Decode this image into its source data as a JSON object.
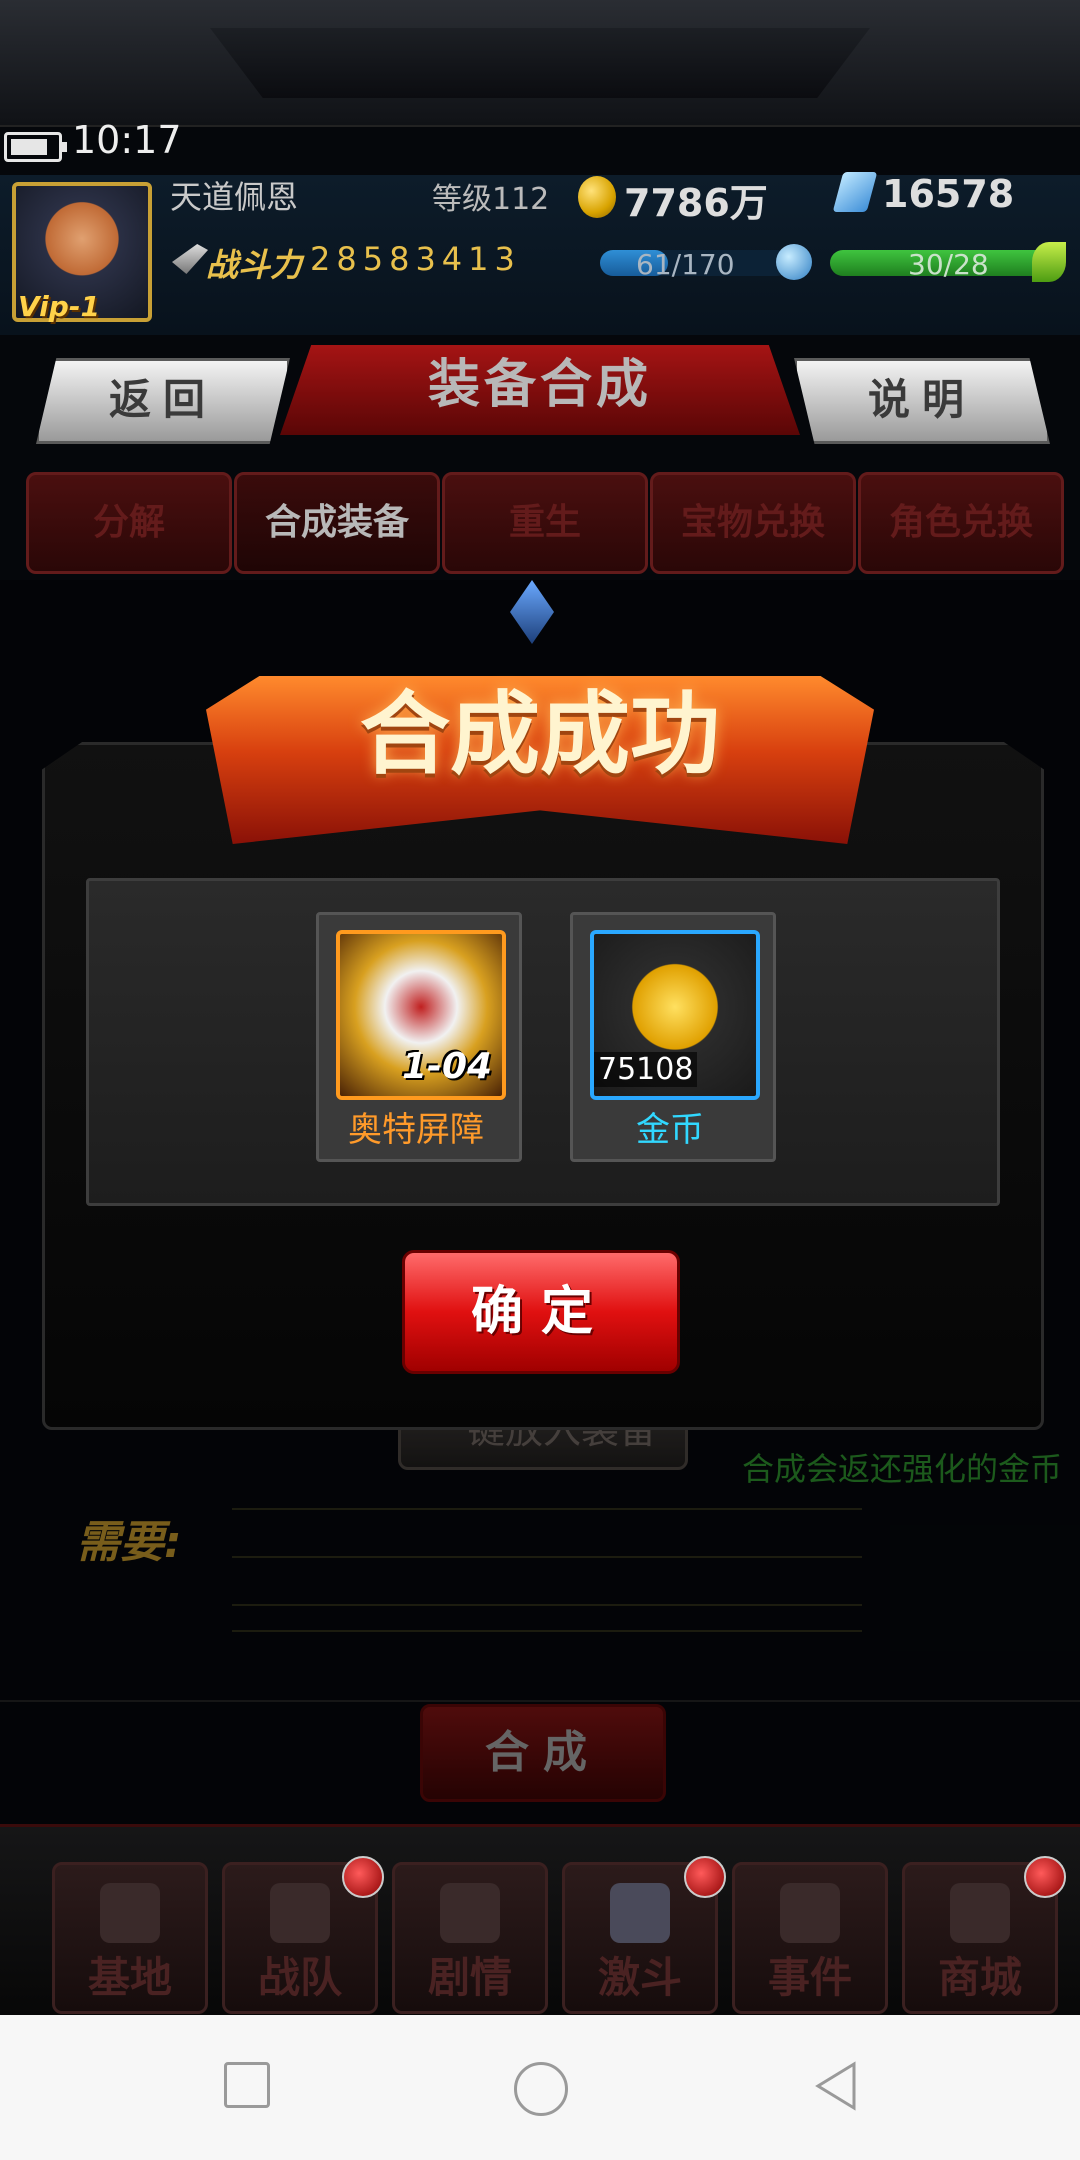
{
  "status_bar": {
    "time": "10:17"
  },
  "player": {
    "name": "天道佩恩",
    "vip": "Vip-1",
    "level": "等级112",
    "gold": "7786万",
    "gems": "16578",
    "power_label": "战斗力",
    "power_value": "28583413",
    "energy": "61/170",
    "energy_fraction": 0.36,
    "stamina": "30/28",
    "stamina_fraction": 1.0
  },
  "header": {
    "title": "装备合成",
    "back_label": "返回",
    "help_label": "说明"
  },
  "tabs": [
    {
      "label": "分解"
    },
    {
      "label": "合成装备",
      "active": true
    },
    {
      "label": "重生"
    },
    {
      "label": "宝物兑换"
    },
    {
      "label": "角色兑换"
    }
  ],
  "modal": {
    "title": "合成成功",
    "items": [
      {
        "name": "奥特屏障",
        "badge": "1-04",
        "icon": "shield-icon"
      },
      {
        "name": "金币",
        "quantity": "75108",
        "icon": "gold-coin-icon"
      }
    ],
    "confirm_label": "确定"
  },
  "background": {
    "auto_fill_label": "一键放入装备",
    "hint": "合成会返还强化的金币",
    "need_label": "需要:",
    "synthesize_label": "合成"
  },
  "bottom_nav": [
    {
      "label": "基地",
      "badge": false
    },
    {
      "label": "战队",
      "badge": true
    },
    {
      "label": "剧情",
      "badge": false
    },
    {
      "label": "激斗",
      "badge": true,
      "active": true
    },
    {
      "label": "事件",
      "badge": false
    },
    {
      "label": "商城",
      "badge": true
    }
  ],
  "colors": {
    "accent_red": "#e01010",
    "gold": "#e8c04c",
    "item_orange": "#ff9a2a",
    "item_cyan": "#31d8ff"
  }
}
